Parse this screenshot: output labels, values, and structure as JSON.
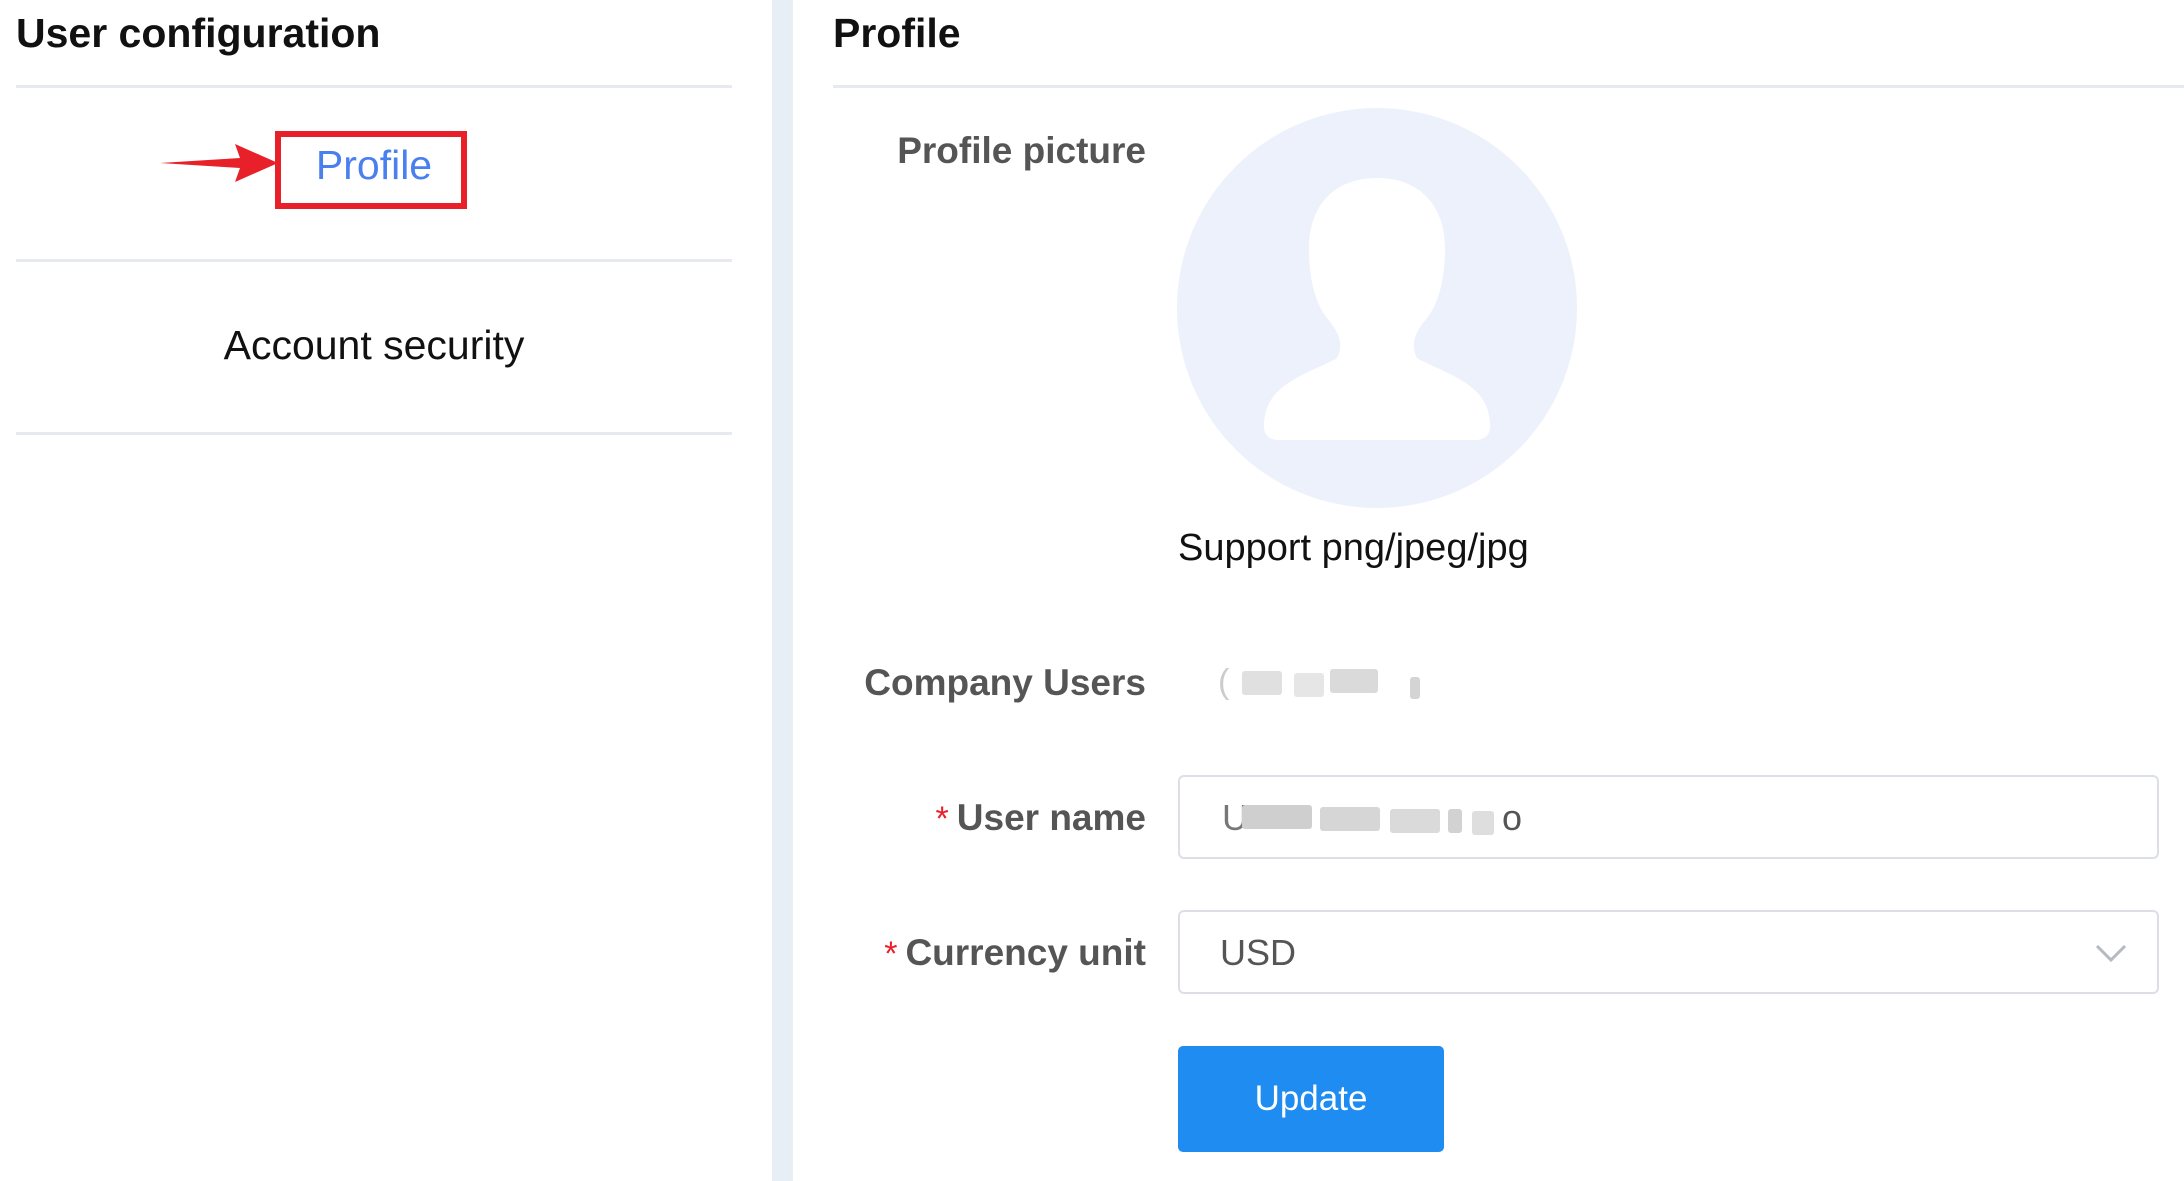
{
  "sidebar": {
    "title": "User configuration",
    "items": [
      {
        "label": "Profile",
        "active": true
      },
      {
        "label": "Account security",
        "active": false
      }
    ]
  },
  "main": {
    "title": "Profile",
    "profile_picture_label": "Profile picture",
    "support_text": "Support png/jpeg/jpg",
    "company_users_label": "Company Users",
    "company_users_value": "(redacted)",
    "username_label": "User name",
    "username_value": "U████ █████ █ o",
    "currency_label": "Currency unit",
    "currency_value": "USD",
    "update_button": "Update"
  },
  "colors": {
    "accent": "#1e8cf0",
    "active_link": "#4a7ff0",
    "highlight": "#e8202a",
    "required": "#e8202a"
  },
  "icons": {
    "avatar": "user-silhouette-icon",
    "dropdown": "chevron-down-icon",
    "annotation": "red-arrow-icon"
  }
}
